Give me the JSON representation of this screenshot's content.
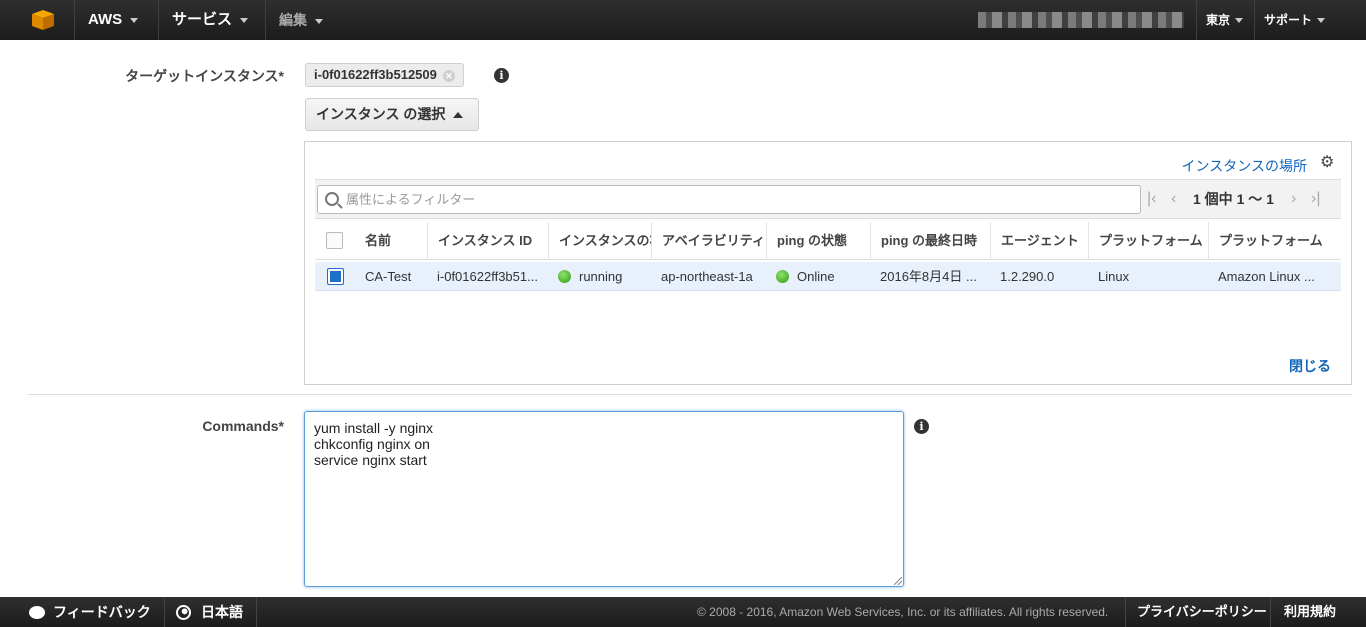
{
  "topnav": {
    "brand": "AWS",
    "services": "サービス",
    "edit": "編集",
    "region": "東京",
    "support": "サポート"
  },
  "form": {
    "target_label": "ターゲットインスタンス*",
    "target_token": "i-0f01622ff3b512509",
    "select_button": "インスタンス の選択",
    "commands_label": "Commands*",
    "commands_value": "yum install -y nginx\nchkconfig nginx on\nservice nginx start\n"
  },
  "panel": {
    "location_link": "インスタンスの場所",
    "filter_placeholder": "属性によるフィルター",
    "pager_text": "1 個中 1 〜 1",
    "close_link": "閉じる",
    "columns": [
      "名前",
      "インスタンス ID",
      "インスタンスの状態",
      "アベイラビリティーゾーン",
      "ping の状態",
      "ping の最終日時",
      "エージェント",
      "プラットフォーム",
      "プラットフォーム"
    ],
    "rows": [
      {
        "name": "CA-Test",
        "instance_id": "i-0f01622ff3b51...",
        "state": "running",
        "az": "ap-northeast-1a",
        "ping": "Online",
        "ping_time": "2016年8月4日 ...",
        "agent": "1.2.290.0",
        "platform_type": "Linux",
        "platform_name": "Amazon Linux ...",
        "status_color": "#3aa81b"
      }
    ]
  },
  "footer": {
    "feedback": "フィードバック",
    "language": "日本語",
    "copyright": "© 2008 - 2016, Amazon Web Services, Inc. or its affiliates. All rights reserved.",
    "privacy": "プライバシーポリシー",
    "terms": "利用規約"
  }
}
